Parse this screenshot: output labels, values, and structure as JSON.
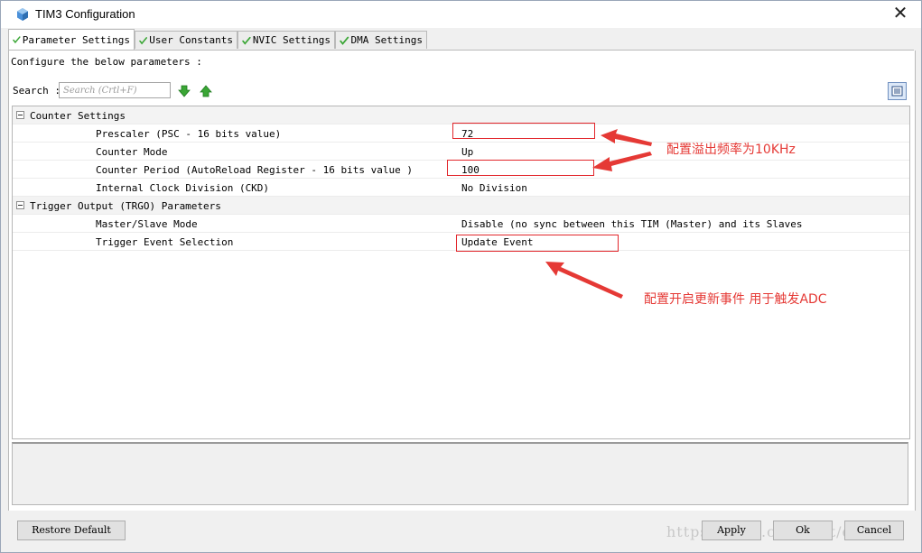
{
  "window": {
    "title": "TIM3 Configuration",
    "close_label": "✕"
  },
  "tabs": [
    {
      "label": "Parameter Settings",
      "active": true
    },
    {
      "label": "User Constants",
      "active": false
    },
    {
      "label": "NVIC Settings",
      "active": false
    },
    {
      "label": "DMA Settings",
      "active": false
    }
  ],
  "intro_text": "Configure the below parameters :",
  "search": {
    "label": "Search :",
    "placeholder": "Search (Crtl+F)"
  },
  "groups": [
    {
      "name": "Counter Settings",
      "params": [
        {
          "name": "Prescaler (PSC - 16 bits value)",
          "value": "72"
        },
        {
          "name": "Counter Mode",
          "value": "Up"
        },
        {
          "name": "Counter Period (AutoReload Register - 16 bits value )",
          "value": "100"
        },
        {
          "name": "Internal Clock Division (CKD)",
          "value": "No Division"
        }
      ]
    },
    {
      "name": "Trigger Output (TRGO) Parameters",
      "params": [
        {
          "name": "Master/Slave Mode",
          "value": "Disable (no sync between this TIM (Master) and its Slaves"
        },
        {
          "name": "Trigger Event Selection",
          "value": "Update Event"
        }
      ]
    }
  ],
  "annotations": {
    "overflow_note": "配置溢出频率为10KHz",
    "trigger_note": "配置开启更新事件 用于触发ADC",
    "color": "#e53935"
  },
  "buttons": {
    "restore_default": "Restore Default",
    "apply": "Apply",
    "ok": "Ok",
    "cancel": "Cancel"
  },
  "watermark": "https://blog.csdn.net/qq_li",
  "colors": {
    "accent_green": "#3aa635",
    "highlight_red": "#e2262b"
  }
}
